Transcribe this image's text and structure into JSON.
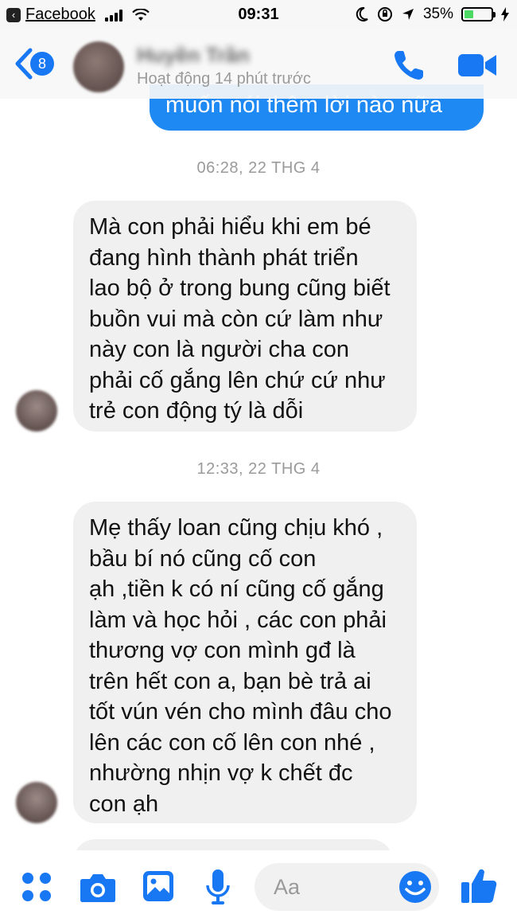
{
  "status_bar": {
    "back_app_label": "Facebook",
    "time": "09:31",
    "battery_percent": "35%",
    "battery_level": 0.35
  },
  "header": {
    "back_count": "8",
    "contact_name": "Huyền Trần",
    "contact_status": "Hoạt động 14 phút trước"
  },
  "messages": {
    "sent_partial": "muốn nói thêm lời nào nữa",
    "timestamp_1": "06:28, 22 THG 4",
    "message_1_lines": [
      "Mà con phải hiểu khi em bé",
      "đang hình thành phát triển",
      "lao bộ ở trong bung cũng biết",
      "buồn vui mà còn cứ làm như",
      "này con là người cha con",
      "phải cố gắng lên chứ cứ như",
      "trẻ con động tý là dỗi"
    ],
    "timestamp_2": "12:33, 22 THG 4",
    "message_2_lines": [
      "Mẹ thấy loan cũng chịu khó ,",
      "bầu bí nó cũng cố con",
      "ạh ,tiền k có ní cũng cố gắng",
      "làm và học hỏi , các con phải",
      "thương vợ con mình gđ là",
      "trên hết con a, bạn bè trả ai",
      "tốt vún vén cho mình đâu cho",
      "lên các con cố lên con nhé ,",
      "nhường nhịn vợ k chết đc",
      "con ạh"
    ]
  },
  "composer": {
    "placeholder": "Aa"
  },
  "colors": {
    "accent": "#1877f2",
    "sent_bubble": "#1e88f3",
    "received_bubble": "#f0f0f0",
    "battery_green": "#4cd964"
  },
  "icons": {
    "status": [
      "back-to-app-icon",
      "signal-icon",
      "wifi-icon",
      "do-not-disturb-icon",
      "orientation-lock-icon",
      "location-icon",
      "battery-icon",
      "charging-icon"
    ],
    "header": [
      "back-chevron-icon",
      "phone-icon",
      "video-camera-icon"
    ],
    "composer": [
      "apps-grid-icon",
      "camera-icon",
      "gallery-icon",
      "microphone-icon",
      "emoji-icon",
      "thumbs-up-icon"
    ]
  }
}
